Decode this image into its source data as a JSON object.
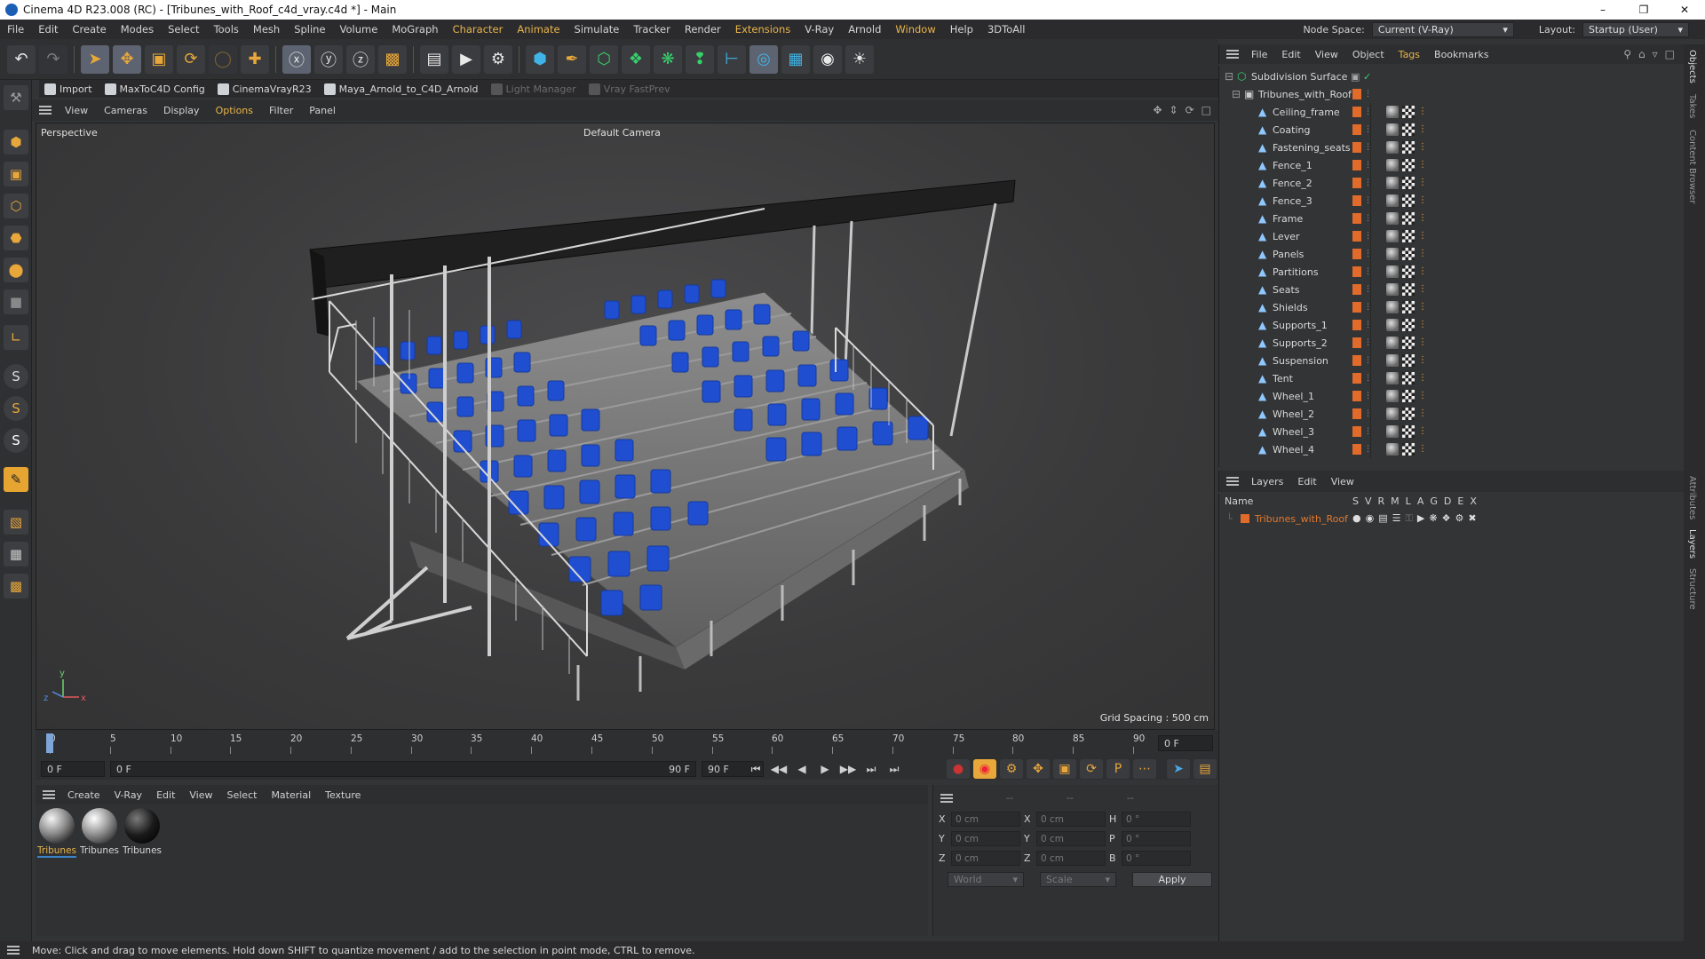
{
  "window": {
    "title": "Cinema 4D R23.008 (RC) - [Tribunes_with_Roof_c4d_vray.c4d *] - Main"
  },
  "menubar": {
    "items": [
      "File",
      "Edit",
      "Create",
      "Modes",
      "Select",
      "Tools",
      "Mesh",
      "Spline",
      "Volume",
      "MoGraph",
      "Character",
      "Animate",
      "Simulate",
      "Tracker",
      "Render",
      "Extensions",
      "V-Ray",
      "Arnold",
      "Window",
      "Help",
      "3DToAll"
    ],
    "node_space_label": "Node Space:",
    "node_space_value": "Current (V-Ray)",
    "layout_label": "Layout:",
    "layout_value": "Startup (User)"
  },
  "pluginbar": {
    "items": [
      "Import",
      "MaxToC4D Config",
      "CinemaVrayR23",
      "Maya_Arnold_to_C4D_Arnold",
      "Light Manager",
      "Vray FastPrev"
    ]
  },
  "viewport_menu": {
    "items": [
      "View",
      "Cameras",
      "Display",
      "Options",
      "Filter",
      "Panel"
    ]
  },
  "viewport": {
    "view_name": "Perspective",
    "camera": "Default Camera",
    "grid_spacing": "Grid Spacing : 500 cm"
  },
  "timeline": {
    "ticks": [
      "0",
      "5",
      "10",
      "15",
      "20",
      "25",
      "30",
      "35",
      "40",
      "45",
      "50",
      "55",
      "60",
      "65",
      "70",
      "75",
      "80",
      "85",
      "90"
    ],
    "current_frame_right": "0 F",
    "start_frame": "0 F",
    "range_start": "0 F",
    "range_end": "90 F",
    "end_frame": "90 F"
  },
  "material_menu": {
    "items": [
      "Create",
      "V-Ray",
      "Edit",
      "View",
      "Select",
      "Material",
      "Texture"
    ]
  },
  "materials": [
    {
      "name": "Tribunes",
      "selected": true
    },
    {
      "name": "Tribunes",
      "selected": false
    },
    {
      "name": "Tribunes",
      "selected": false
    }
  ],
  "coordinates": {
    "header": [
      "--",
      "--",
      "--"
    ],
    "rows": [
      {
        "axis1": "X",
        "v1": "0 cm",
        "axis2": "X",
        "v2": "0 cm",
        "axis3": "H",
        "v3": "0 °"
      },
      {
        "axis1": "Y",
        "v1": "0 cm",
        "axis2": "Y",
        "v2": "0 cm",
        "axis3": "P",
        "v3": "0 °"
      },
      {
        "axis1": "Z",
        "v1": "0 cm",
        "axis2": "Z",
        "v2": "0 cm",
        "axis3": "B",
        "v3": "0 °"
      }
    ],
    "mode": "World",
    "transform": "Scale",
    "apply_label": "Apply"
  },
  "status": {
    "text": "Move: Click and drag to move elements. Hold down SHIFT to quantize movement / add to the selection in point mode, CTRL to remove."
  },
  "object_menu": {
    "items": [
      "File",
      "Edit",
      "View",
      "Object",
      "Tags",
      "Bookmarks"
    ]
  },
  "objects": {
    "root": "Subdivision Surface",
    "group": "Tribunes_with_Roof",
    "children": [
      "Ceiling_frame",
      "Coating",
      "Fastening_seats",
      "Fence_1",
      "Fence_2",
      "Fence_3",
      "Frame",
      "Lever",
      "Panels",
      "Partitions",
      "Seats",
      "Shields",
      "Supports_1",
      "Supports_2",
      "Suspension",
      "Tent",
      "Wheel_1",
      "Wheel_2",
      "Wheel_3",
      "Wheel_4"
    ]
  },
  "layers_menu": {
    "items": [
      "Layers",
      "Edit",
      "View"
    ]
  },
  "layers": {
    "header_name": "Name",
    "header_cols": [
      "S",
      "V",
      "R",
      "M",
      "L",
      "A",
      "G",
      "D",
      "E",
      "X"
    ],
    "rows": [
      {
        "name": "Tribunes_with_Roof",
        "color": "#e06b2a"
      }
    ]
  },
  "right_tabs": [
    "Objects",
    "Takes",
    "Content Browser",
    "Attributes",
    "Layers",
    "Structure"
  ],
  "colors": {
    "accent": "#e9b54a",
    "layer_orange": "#e06b2a",
    "seat_blue": "#1f4fd0"
  }
}
